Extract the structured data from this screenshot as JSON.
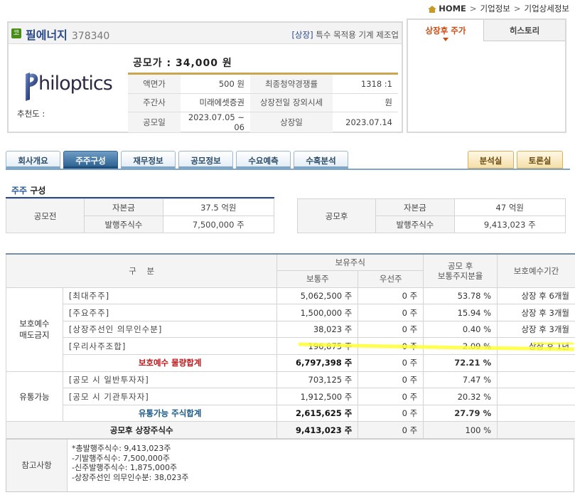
{
  "breadcrumb": {
    "home": "HOME",
    "items": [
      "기업정보",
      "기업상세정보"
    ]
  },
  "company": {
    "badge": "코",
    "name": "필에너지",
    "code": "378340",
    "market_tag": "[상장]",
    "sector": "특수 목적용 기계 제조업",
    "logo_text": "hiloptics",
    "recommend_label": "추천도 :"
  },
  "offer": {
    "price_title": "공모가 : 34,000 원",
    "rows": [
      {
        "l1": "액면가",
        "v1": "500 원",
        "l2": "최종청약경쟁률",
        "v2": "1318 :1"
      },
      {
        "l1": "주간사",
        "v1": "미래에셋증권",
        "l2": "상장전일 장외시세",
        "v2": "원"
      },
      {
        "l1": "공모일",
        "v1": "2023.07.05 ~ 06",
        "l2": "상장일",
        "v2": "2023.07.14"
      }
    ]
  },
  "side_tabs": {
    "tab1": "상장후 주가",
    "tab2": "히스토리"
  },
  "nav_tabs": [
    "회사개요",
    "주주구성",
    "재무정보",
    "공모정보",
    "수요예측",
    "수혹분석"
  ],
  "nav_tabs_right": [
    "분석실",
    "토론실"
  ],
  "section": {
    "hl": "주주",
    "rest": " 구성"
  },
  "cap_before": {
    "label": "공모전",
    "r1l": "자본금",
    "r1v": "37.5 억원",
    "r2l": "발행주식수",
    "r2v": "7,500,000 주"
  },
  "cap_after": {
    "label": "공모후",
    "r1l": "자본금",
    "r1v": "47 억원",
    "r2l": "발행주식수",
    "r2v": "9,413,023 주"
  },
  "table": {
    "h_cat": "구    분",
    "h_hold": "보유주식",
    "h_common": "보통주",
    "h_pref": "우선주",
    "h_ratio": "공모 후\n보통주지분율",
    "h_lock": "보호예수기간",
    "group1": "보호예수\n매도금지",
    "group2": "유통가능",
    "rows1": [
      {
        "name": "[최대주주]",
        "common": "5,062,500 주",
        "pref": "0 주",
        "ratio": "53.78 %",
        "lock": "상장 후 6개월"
      },
      {
        "name": "[주요주주]",
        "common": "1,500,000 주",
        "pref": "0 주",
        "ratio": "15.94 %",
        "lock": "상장 후 3개월"
      },
      {
        "name": "[상장주선인 의무인수분]",
        "common": "38,023 주",
        "pref": "0 주",
        "ratio": "0.40 %",
        "lock": "상장 후 3개월"
      },
      {
        "name": "[우리사주조합]",
        "common": "196,875 주",
        "pref": "0 주",
        "ratio": "2.09 %",
        "lock": "상장 후 1년"
      }
    ],
    "sub1": {
      "name": "보호예수 물량합계",
      "common": "6,797,398 주",
      "pref": "0 주",
      "ratio": "72.21 %"
    },
    "rows2": [
      {
        "name": "[공모 시 일반투자자]",
        "common": "703,125 주",
        "pref": "0 주",
        "ratio": "7.47 %"
      },
      {
        "name": "[공모 시 기관투자자]",
        "common": "1,912,500 주",
        "pref": "0 주",
        "ratio": "20.32 %"
      }
    ],
    "sub2": {
      "name": "유통가능 주식합계",
      "common": "2,615,625 주",
      "pref": "0 주",
      "ratio": "27.79 %"
    },
    "grand": {
      "name": "공모후 상장주식수",
      "common": "9,413,023 주",
      "pref": "0 주",
      "ratio": "100 %"
    }
  },
  "note": {
    "label": "참고사항",
    "lines": [
      "*총발행주식수: 9,413,023주",
      "-기발행주식수: 7,500,000주",
      "-신주발행주식수: 1,875,000주",
      "-상장주선인 의무인수분: 38,023주"
    ]
  },
  "colors": {
    "accent_blue": "#2f6493",
    "red": "#c0181a",
    "highlight": "#ffff33"
  }
}
